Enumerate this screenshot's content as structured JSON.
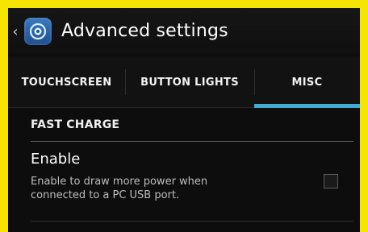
{
  "colors": {
    "frame": "#f4e400",
    "background": "#0d0d0d",
    "accent": "#3faad2",
    "text_primary": "#ffffff",
    "text_secondary": "#bdbdbd"
  },
  "action_bar": {
    "up_icon": "chevron-left-icon",
    "app_icon": "settings-target-icon",
    "title": "Advanced settings"
  },
  "tabs": [
    {
      "label": "TOUCHSCREEN",
      "selected": false
    },
    {
      "label": "BUTTON LIGHTS",
      "selected": false
    },
    {
      "label": "MISC",
      "selected": true
    }
  ],
  "section": {
    "title": "FAST CHARGE"
  },
  "preference": {
    "title": "Enable",
    "summary": "Enable to draw more power when connected to a PC USB port.",
    "checked": false
  }
}
